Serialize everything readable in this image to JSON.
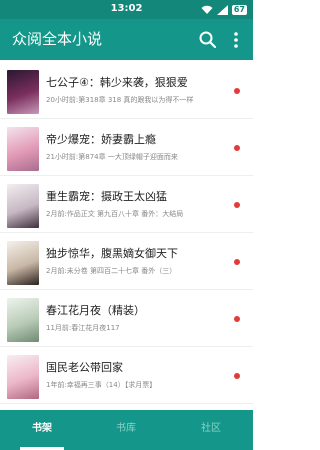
{
  "status_bar": {
    "time": "13:02",
    "battery": "67",
    "icons": [
      "wifi-icon",
      "signal-icon",
      "battery-icon"
    ]
  },
  "app_bar": {
    "title": "众阅全本小说",
    "icons": [
      "search-icon",
      "more-vert-icon"
    ]
  },
  "books": [
    {
      "title": "七公子④：韩少来袭，狠狠爱",
      "meta": "20小时前:第318章 318 真的跟我以为得不一样",
      "unread": true,
      "cover_colors": [
        "#2b1730",
        "#7a2f5e",
        "#c89ab8"
      ]
    },
    {
      "title": "帝少爆宠：娇妻霸上瘾",
      "meta": "21小时前:第874章 一大顶绿帽子迎面而来",
      "unread": true,
      "cover_colors": [
        "#f3e3ec",
        "#e29ab6",
        "#a86d8e"
      ]
    },
    {
      "title": "重生霸宠：摄政王太凶猛",
      "meta": "2月前:作品正文 第九百八十章 番外：大结局",
      "unread": true,
      "cover_colors": [
        "#f1eef0",
        "#c7b8c4",
        "#3d2f3c"
      ]
    },
    {
      "title": "独步惊华，腹黑嫡女御天下",
      "meta": "2月前:未分卷 第四百二十七章 番外（三）",
      "unread": true,
      "cover_colors": [
        "#f4f0ea",
        "#c8b7a5",
        "#2a211c"
      ]
    },
    {
      "title": "春江花月夜（精装）",
      "meta": "11月前:春江花月夜117",
      "unread": true,
      "cover_colors": [
        "#eef3ee",
        "#b9ccb7",
        "#6f8a73"
      ]
    },
    {
      "title": "国民老公带回家",
      "meta": "1年前:幸福再三事（14）【求月票】",
      "unread": true,
      "cover_colors": [
        "#f8eef2",
        "#ecb6c8",
        "#b0687f"
      ]
    }
  ],
  "bottom_nav": [
    {
      "label": "书架",
      "active": true
    },
    {
      "label": "书库",
      "active": false
    },
    {
      "label": "社区",
      "active": false
    }
  ],
  "colors": {
    "primary": "#14978a",
    "status_bar": "#12877a",
    "unread_dot": "#e33a3a"
  }
}
